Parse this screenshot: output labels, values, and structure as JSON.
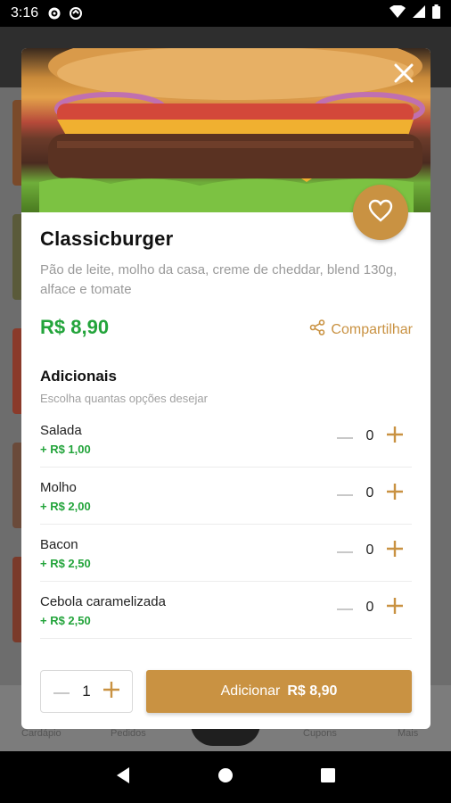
{
  "status_bar": {
    "time": "3:16"
  },
  "background": {
    "nav_labels": [
      "Cardápio",
      "Pedidos",
      "Cupons",
      "Mais"
    ]
  },
  "product": {
    "title": "Classicburger",
    "description": "Pão de leite, molho da casa, creme de cheddar, blend 130g, alface e tomate",
    "price": "R$ 8,90",
    "share_label": "Compartilhar"
  },
  "addons": {
    "title": "Adicionais",
    "subtitle": "Escolha quantas opções desejar",
    "items": [
      {
        "name": "Salada",
        "price": "+ R$ 1,00",
        "qty": "0"
      },
      {
        "name": "Molho",
        "price": "+ R$ 2,00",
        "qty": "0"
      },
      {
        "name": "Bacon",
        "price": "+ R$ 2,50",
        "qty": "0"
      },
      {
        "name": "Cebola caramelizada",
        "price": "+ R$ 2,50",
        "qty": "0"
      }
    ]
  },
  "footer": {
    "quantity": "1",
    "add_label": "Adicionar",
    "add_amount": "R$ 8,90"
  },
  "colors": {
    "accent": "#c99242",
    "price_green": "#23a43b"
  },
  "icons": [
    "settings-icon",
    "sync-icon",
    "wifi-icon",
    "signal-icon",
    "battery-icon",
    "close-icon",
    "heart-icon",
    "share-icon",
    "minus-icon",
    "plus-icon",
    "back-icon",
    "home-icon",
    "recents-icon"
  ]
}
